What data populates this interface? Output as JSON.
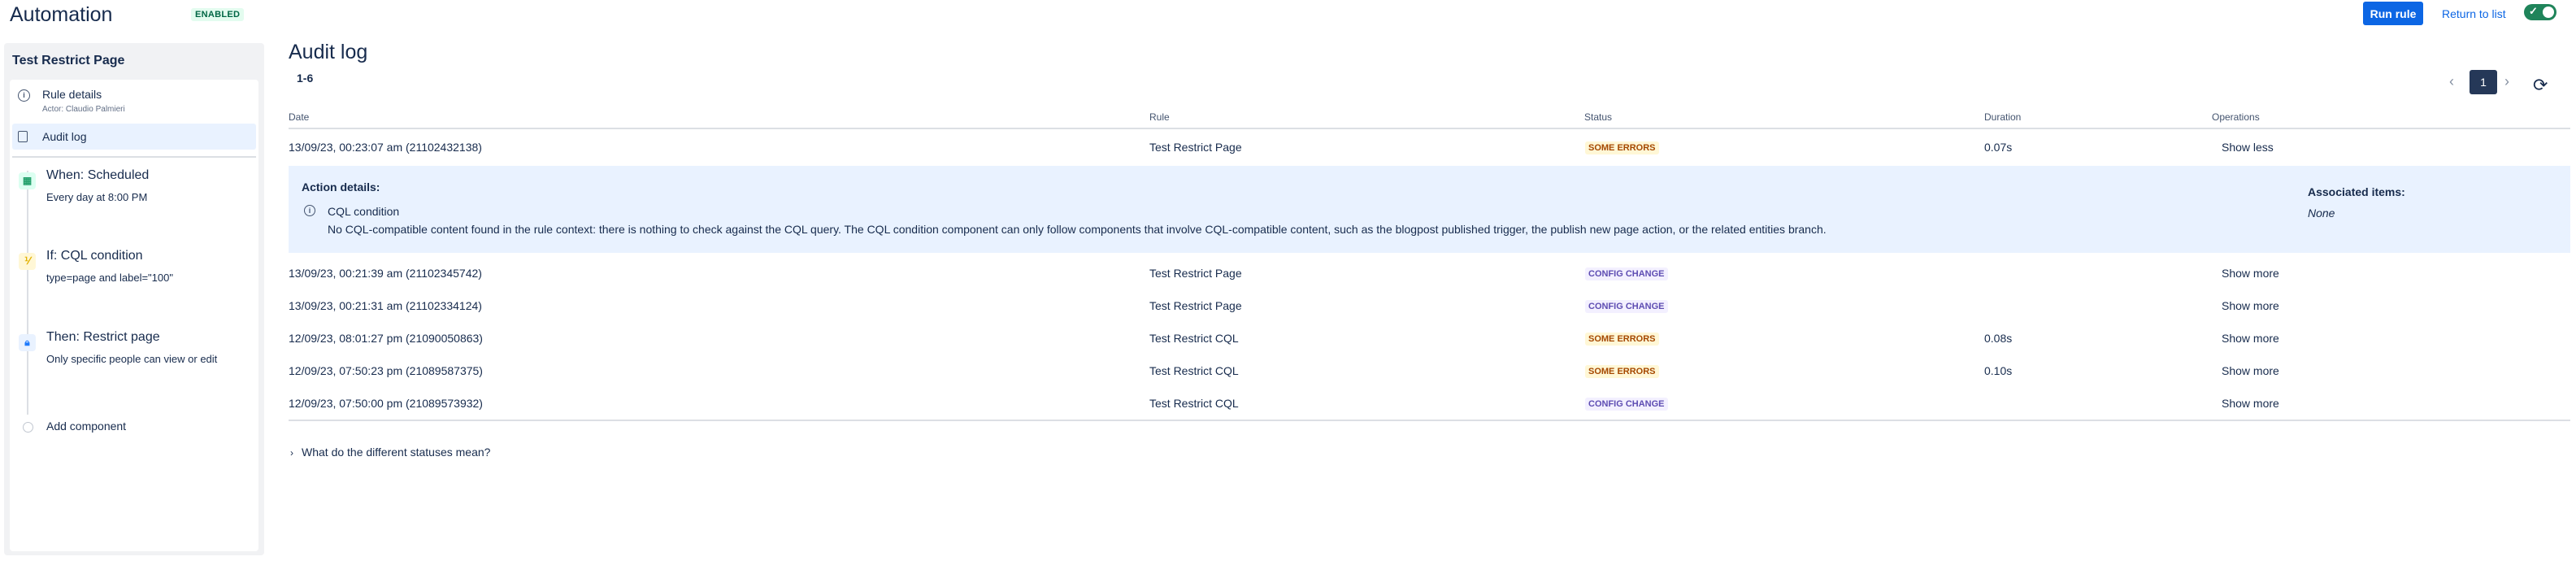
{
  "header": {
    "title": "Automation",
    "status_badge": "ENABLED",
    "run_rule": "Run rule",
    "return_to_list": "Return to list",
    "toggle_checked": true
  },
  "sidebar": {
    "rule_name": "Test Restrict Page",
    "rule_details": {
      "label": "Rule details",
      "actor": "Actor: Claudio Palmieri"
    },
    "audit_log": {
      "label": "Audit log"
    },
    "components": [
      {
        "type": "trigger",
        "title": "When: Scheduled",
        "subtitle": "Every day at 8:00 PM",
        "icon": "calendar-icon",
        "color": "#22a06b"
      },
      {
        "type": "condition",
        "title": "If: CQL condition",
        "subtitle": "type=page and label=\"100\"",
        "icon": "condition-icon",
        "color": "#e2b203"
      },
      {
        "type": "action",
        "title": "Then: Restrict page",
        "subtitle": "Only specific people can view or edit",
        "icon": "lock-icon",
        "color": "#1d7afc"
      }
    ],
    "add_component": "Add component"
  },
  "main": {
    "title": "Audit log",
    "range": "1-6",
    "pagination": {
      "current": "1"
    },
    "columns": [
      "Date",
      "Rule",
      "Status",
      "Duration",
      "Operations"
    ],
    "rows": [
      {
        "date": "13/09/23, 00:23:07 am (21102432138)",
        "rule": "Test Restrict Page",
        "status": "SOME ERRORS",
        "status_kind": "error",
        "duration": "0.07s",
        "op": "Show less"
      },
      {
        "date": "13/09/23, 00:21:39 am (21102345742)",
        "rule": "Test Restrict Page",
        "status": "CONFIG CHANGE",
        "status_kind": "config",
        "duration": "",
        "op": "Show more"
      },
      {
        "date": "13/09/23, 00:21:31 am (21102334124)",
        "rule": "Test Restrict Page",
        "status": "CONFIG CHANGE",
        "status_kind": "config",
        "duration": "",
        "op": "Show more"
      },
      {
        "date": "12/09/23, 08:01:27 pm (21090050863)",
        "rule": "Test Restrict CQL",
        "status": "SOME ERRORS",
        "status_kind": "error",
        "duration": "0.08s",
        "op": "Show more"
      },
      {
        "date": "12/09/23, 07:50:23 pm (21089587375)",
        "rule": "Test Restrict CQL",
        "status": "SOME ERRORS",
        "status_kind": "error",
        "duration": "0.10s",
        "op": "Show more"
      },
      {
        "date": "12/09/23, 07:50:00 pm (21089573932)",
        "rule": "Test Restrict CQL",
        "status": "CONFIG CHANGE",
        "status_kind": "config",
        "duration": "",
        "op": "Show more"
      }
    ],
    "details": {
      "heading": "Action details:",
      "component": "CQL condition",
      "message": "No CQL-compatible content found in the rule context: there is nothing to check against the CQL query. The CQL condition component can only follow components that involve CQL-compatible content, such as the blogpost published trigger, the publish new page action, or the related entities branch.",
      "associated_heading": "Associated items:",
      "associated_value": "None"
    },
    "statuses_link": "What do the different statuses mean?"
  }
}
